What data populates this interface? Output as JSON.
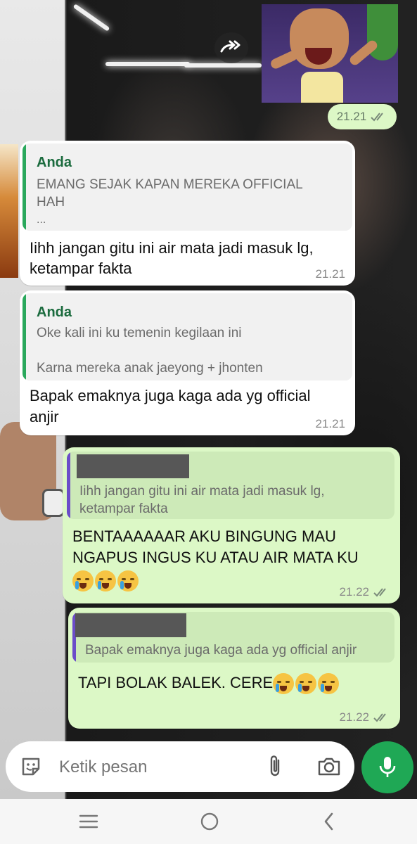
{
  "chat": {
    "sticker_message": {
      "time": "21.21",
      "status_icon": "double-check-icon"
    },
    "messages": [
      {
        "direction": "incoming",
        "quote_author": "Anda",
        "quote_lines": [
          "EMANG SEJAK KAPAN MEREKA OFFICIAL",
          "HAH",
          "..."
        ],
        "text_lines": [
          "Iihh jangan gitu ini air mata jadi masuk lg,",
          "ketampar fakta"
        ],
        "time": "21.21"
      },
      {
        "direction": "incoming",
        "quote_author": "Anda",
        "quote_lines": [
          "Oke kali ini ku temenin kegilaan ini",
          "Karna mereka anak jaeyong + jhonten"
        ],
        "text_lines": [
          "Bapak emaknya juga kaga ada yg official",
          "anjir"
        ],
        "time": "21.21"
      },
      {
        "direction": "outgoing",
        "quote_lines": [
          "Iihh jangan gitu ini air mata jadi masuk lg,",
          "ketampar fakta"
        ],
        "text_lines": [
          "BENTAAAAAAR AKU BINGUNG MAU",
          "NGAPUS INGUS KU ATAU AIR MATA KU"
        ],
        "time": "21.22"
      },
      {
        "direction": "outgoing",
        "quote_lines": [
          "Bapak emaknya juga kaga ada yg official anjir"
        ],
        "text_lines": [
          "TAPI BOLAK BALEK. CERE"
        ],
        "time": "21.22"
      }
    ]
  },
  "composer": {
    "placeholder": "Ketik pesan",
    "icons": [
      "sticker-icon",
      "attach-icon",
      "camera-icon",
      "mic-icon"
    ]
  },
  "colors": {
    "outgoing_bubble": "#dcf8c6",
    "incoming_bubble": "#ffffff",
    "accent_green": "#1fa855",
    "quote_author": "#1b6b3e"
  },
  "nav": {
    "icons": [
      "recent-apps-icon",
      "home-icon",
      "back-icon"
    ]
  }
}
